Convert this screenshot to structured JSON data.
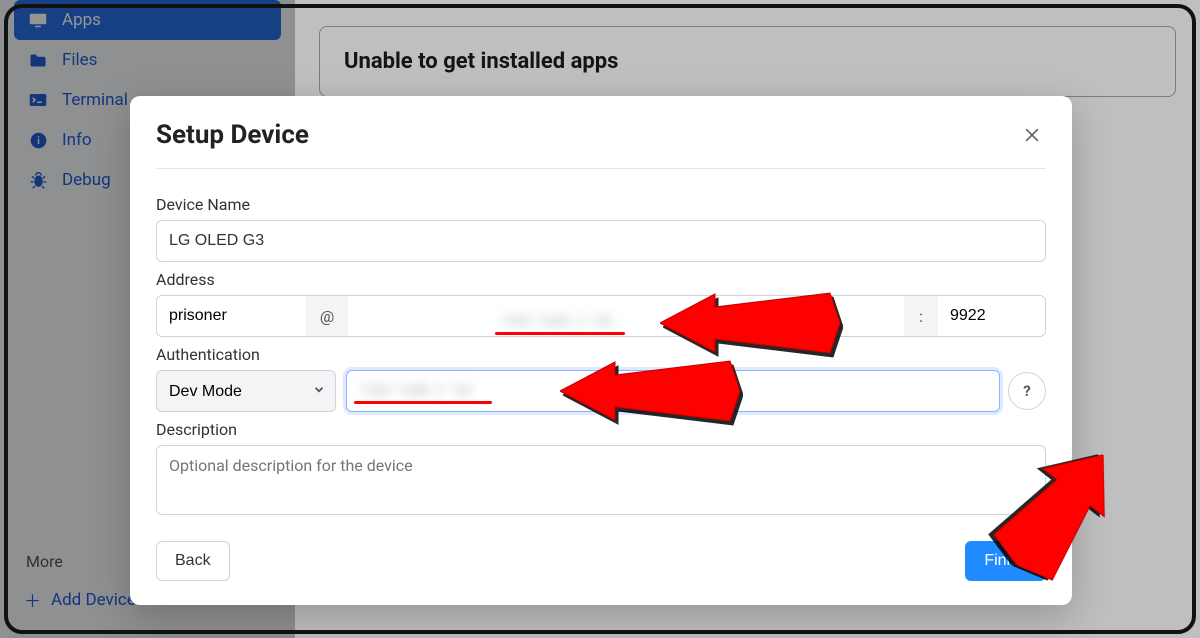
{
  "sidebar": {
    "items": [
      {
        "label": "Apps",
        "icon": "monitor-icon",
        "active": true
      },
      {
        "label": "Files",
        "icon": "folder-icon",
        "active": false
      },
      {
        "label": "Terminal",
        "icon": "terminal-icon",
        "active": false
      },
      {
        "label": "Info",
        "icon": "info-icon",
        "active": false
      },
      {
        "label": "Debug",
        "icon": "bug-icon",
        "active": false
      }
    ],
    "moreLabel": "More",
    "addDeviceLabel": "Add Device"
  },
  "main": {
    "cardTitle": "Unable to get installed apps"
  },
  "modal": {
    "title": "Setup Device",
    "labels": {
      "deviceName": "Device Name",
      "address": "Address",
      "authentication": "Authentication",
      "description": "Description"
    },
    "values": {
      "deviceName": "LG OLED G3",
      "user": "prisoner",
      "atSymbol": "@",
      "colonSymbol": ":",
      "port": "9922",
      "authSelected": "Dev Mode",
      "descriptionPlaceholder": "Optional description for the device",
      "helpSymbol": "?"
    },
    "buttons": {
      "back": "Back",
      "finish": "Finish"
    }
  }
}
